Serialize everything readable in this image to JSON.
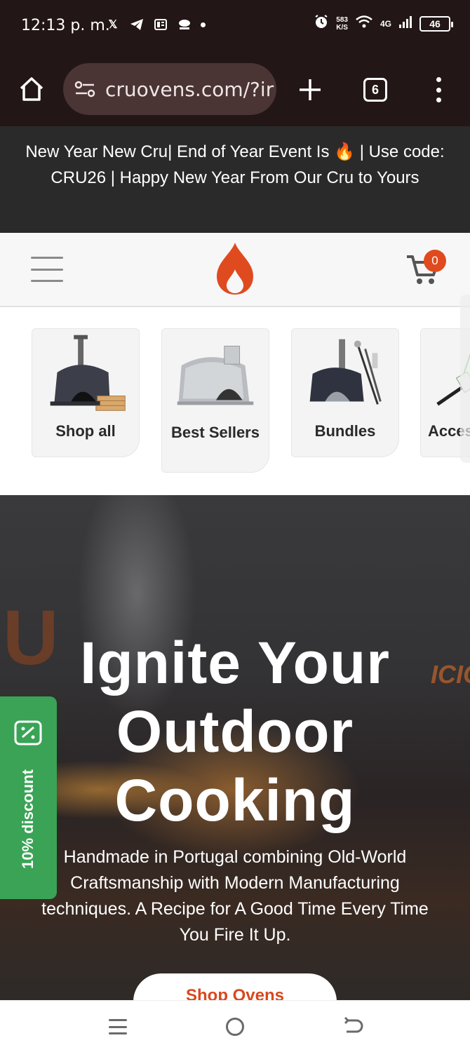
{
  "status_bar": {
    "time": "12:13 p. m.",
    "network_speed_value": "583",
    "network_speed_unit": "K/S",
    "network_type": "4G",
    "battery": "46",
    "app_icons": [
      "x-icon",
      "telegram-icon",
      "news-icon",
      "bnc-icon"
    ]
  },
  "browser": {
    "url": "cruovens.com/?ir",
    "tab_count": "6"
  },
  "announcement": {
    "text": "New Year New Cru| End of Year Event Is 🔥 | Use code: CRU26 | Happy New Year From Our Cru to Yours"
  },
  "header": {
    "cart_count": "0",
    "accent_color": "#e04a1f"
  },
  "categories": [
    {
      "label": "Shop all"
    },
    {
      "label": "Best Sellers"
    },
    {
      "label": "Bundles"
    },
    {
      "label": "Acces"
    }
  ],
  "hero": {
    "brand_fragment": "ICIO",
    "title": "Ignite Your Outdoor Cooking",
    "subtitle": "Handmade in Portugal combining Old-World Craftsmanship with Modern Manufacturing techniques. A Recipe for A Good Time Every Time You Fire It Up.",
    "cta_label": "Shop Ovens"
  },
  "discount_tab": {
    "label": "10% discount",
    "color": "#3aa356"
  }
}
